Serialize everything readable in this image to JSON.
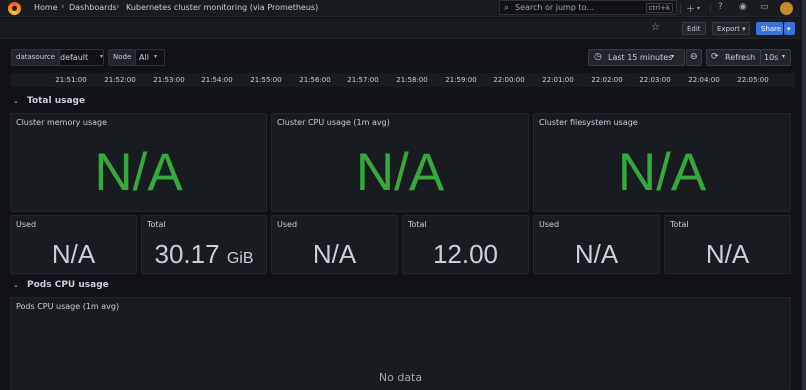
{
  "topbar": {
    "breadcrumb": [
      "Home",
      "Dashboards",
      "Kubernetes cluster monitoring (via Prometheus)"
    ],
    "search_placeholder": "Search or jump to...",
    "search_shortcut": "ctrl+k",
    "icons": [
      "plus-icon",
      "help-icon",
      "rss-icon",
      "monitor-icon",
      "avatar"
    ]
  },
  "toolbar": {
    "edit_label": "Edit",
    "export_label": "Export",
    "share_label": "Share"
  },
  "variables": {
    "datasource": {
      "label": "datasource",
      "value": "default"
    },
    "node": {
      "label": "Node",
      "value": "All"
    }
  },
  "time": {
    "range_label": "Last 15 minutes",
    "refresh_label": "Refresh",
    "refresh_interval": "10s",
    "ticks": [
      "21:51:00",
      "21:52:00",
      "21:53:00",
      "21:54:00",
      "21:55:00",
      "21:56:00",
      "21:57:00",
      "21:58:00",
      "21:59:00",
      "22:00:00",
      "22:01:00",
      "22:02:00",
      "22:03:00",
      "22:04:00",
      "22:05:00"
    ]
  },
  "rows": [
    {
      "title": "Total usage",
      "big_panels": [
        {
          "title": "Cluster memory usage",
          "value": "N/A"
        },
        {
          "title": "Cluster CPU usage (1m avg)",
          "value": "N/A"
        },
        {
          "title": "Cluster filesystem usage",
          "value": "N/A"
        }
      ],
      "small_panels": [
        {
          "title": "Used",
          "value": "N/A",
          "unit": ""
        },
        {
          "title": "Total",
          "value": "30.17",
          "unit": "GiB"
        },
        {
          "title": "Used",
          "value": "N/A",
          "unit": ""
        },
        {
          "title": "Total",
          "value": "12.00",
          "unit": ""
        },
        {
          "title": "Used",
          "value": "N/A",
          "unit": ""
        },
        {
          "title": "Total",
          "value": "N/A",
          "unit": ""
        }
      ]
    },
    {
      "title": "Pods CPU usage",
      "panel": {
        "title": "Pods CPU usage (1m avg)",
        "empty_text": "No data"
      }
    }
  ],
  "colors": {
    "stat_green": "#36a83d",
    "primary_blue": "#3d71d9",
    "background": "#111217",
    "panel": "#181b1f"
  }
}
